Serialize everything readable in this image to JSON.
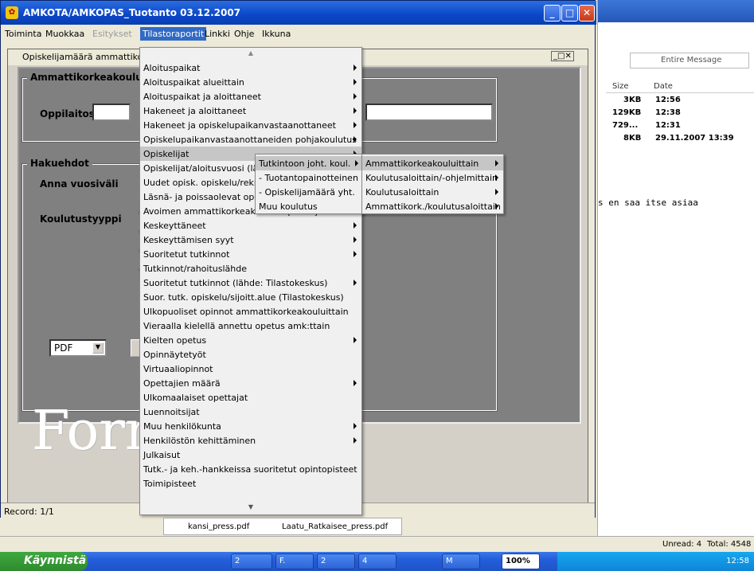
{
  "window": {
    "title": "AMKOTA/AMKOPAS_Tuotanto 03.12.2007"
  },
  "menubar": [
    {
      "label": "Toiminta",
      "state": "normal"
    },
    {
      "label": "Muokkaa",
      "state": "normal"
    },
    {
      "label": "Esitykset",
      "state": "disabled"
    },
    {
      "label": "Tilastoraportit",
      "state": "active"
    },
    {
      "label": "Linkki",
      "state": "normal"
    },
    {
      "label": "Ohje",
      "state": "normal"
    },
    {
      "label": "Ikkuna",
      "state": "normal"
    }
  ],
  "subwindow": {
    "title": "Opiskelijamäärä ammattiko"
  },
  "form": {
    "group1": "Ammattikorkeakoulu",
    "oppilaitos_label": "Oppilaitos",
    "group2": "Hakuehdot",
    "vuosivali_label": "Anna vuosiväli",
    "koulutustyyppi_label": "Koulutustyyppi",
    "format_select": "PDF",
    "logo": "Forms"
  },
  "record": "Record: 1/1",
  "menu1": [
    {
      "label": "Aloituspaikat",
      "sub": true
    },
    {
      "label": "Aloituspaikat alueittain",
      "sub": true
    },
    {
      "label": "Aloituspaikat ja aloittaneet",
      "sub": true
    },
    {
      "label": "Hakeneet ja aloittaneet",
      "sub": true
    },
    {
      "label": "Hakeneet ja opiskelupaikanvastaanottaneet",
      "sub": true
    },
    {
      "label": "Opiskelupaikanvastaanottaneiden pohjakoulutus",
      "sub": true
    },
    {
      "label": "Opiskelijat",
      "sub": true,
      "selected": true
    },
    {
      "label": "Opiskelijat/aloitusvuosi (läh",
      "sub": false
    },
    {
      "label": "Uudet opisk. opiskelu/rekryt",
      "sub": false
    },
    {
      "label": "Läsnä- ja poissaolevat opis",
      "sub": false
    },
    {
      "label": "Avoimen ammattikorkeakoulun opiskelijat",
      "sub": true
    },
    {
      "label": "Keskeyttäneet",
      "sub": true
    },
    {
      "label": "Keskeyttämisen syyt",
      "sub": true
    },
    {
      "label": "Suoritetut tutkinnot",
      "sub": true
    },
    {
      "label": "Tutkinnot/rahoituslähde",
      "sub": false
    },
    {
      "label": "Suoritetut tutkinnot (lähde: Tilastokeskus)",
      "sub": true
    },
    {
      "label": "Suor. tutk. opiskelu/sijoitt.alue (Tilastokeskus)",
      "sub": false
    },
    {
      "label": "Ulkopuoliset opinnot ammattikorkeakouluittain",
      "sub": false
    },
    {
      "label": "Vieraalla kielellä annettu opetus amk:ttain",
      "sub": false
    },
    {
      "label": "Kielten opetus",
      "sub": true
    },
    {
      "label": "Opinnäytetyöt",
      "sub": false
    },
    {
      "label": "Virtuaaliopinnot",
      "sub": false
    },
    {
      "label": "Opettajien määrä",
      "sub": true
    },
    {
      "label": "Ulkomaalaiset opettajat",
      "sub": false
    },
    {
      "label": "Luennoitsijat",
      "sub": false
    },
    {
      "label": "Muu henkilökunta",
      "sub": true
    },
    {
      "label": "Henkilöstön kehittäminen",
      "sub": true
    },
    {
      "label": "Julkaisut",
      "sub": false
    },
    {
      "label": "Tutk.- ja keh.-hankkeissa suoritetut opintopisteet",
      "sub": false
    },
    {
      "label": "Toimipisteet",
      "sub": false
    }
  ],
  "menu2": [
    {
      "label": "Tutkintoon joht. koul.",
      "selected": true
    },
    {
      "label": "- Tuotantopainotteinen"
    },
    {
      "label": "- Opiskelijamäärä yht."
    },
    {
      "label": "Muu koulutus"
    }
  ],
  "menu3": [
    {
      "label": "Ammattikorkeakouluittain",
      "selected": true
    },
    {
      "label": "Koulutusaloittain/-ohjelmittain"
    },
    {
      "label": "Koulutusaloittain"
    },
    {
      "label": "Ammattikork./koulutusaloittain"
    }
  ],
  "outlook": {
    "search_placeholder": "Entire Message",
    "col_size": "Size",
    "col_date": "Date",
    "rows": [
      {
        "size": "3KB",
        "date": "12:56"
      },
      {
        "size": "129KB",
        "date": "12:38"
      },
      {
        "size": "729...",
        "date": "12:31"
      },
      {
        "size": "8KB",
        "date": "29.11.2007 13:39"
      }
    ],
    "preview_text": "s en saa itse asiaa",
    "status_unread": "Unread: 4",
    "status_total": "Total: 4548"
  },
  "pdfbar": [
    "kansi_press.pdf",
    "Laatu_Ratkaisee_press.pdf"
  ],
  "taskbar": {
    "start": "Käynnistä",
    "buttons": [
      "2",
      "F.",
      "2",
      "4",
      "M",
      "100%"
    ],
    "clock": "12:58"
  }
}
